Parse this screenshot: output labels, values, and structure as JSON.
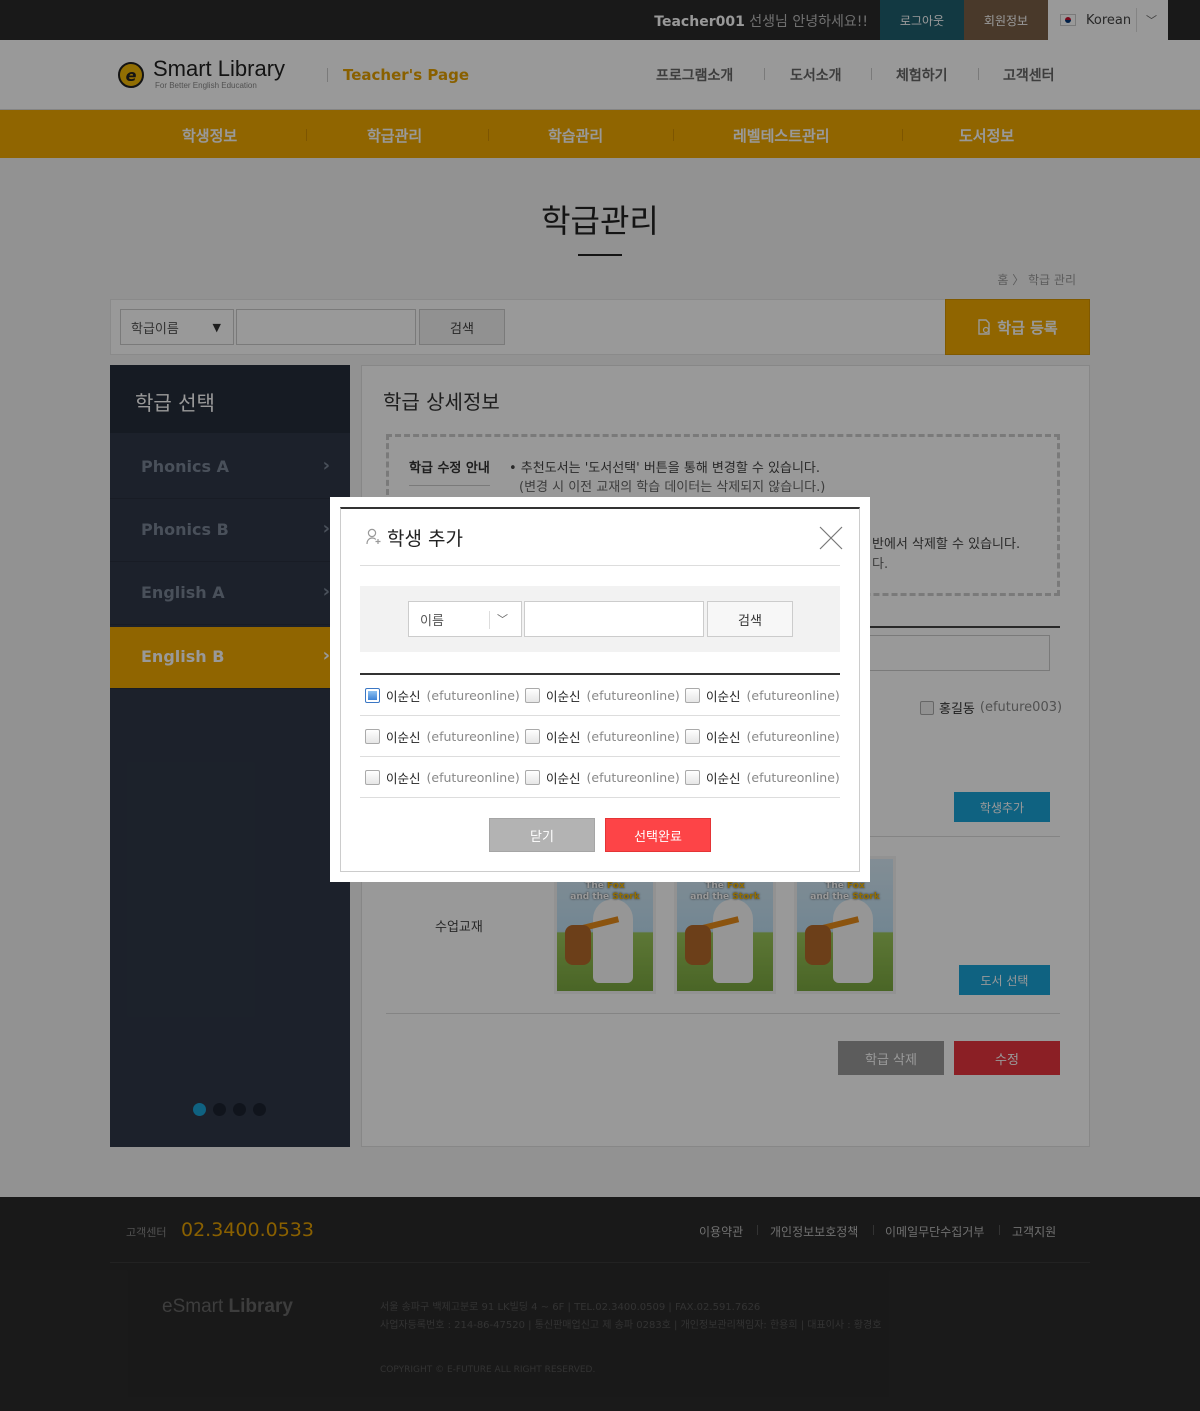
{
  "top_bar": {
    "user": "Teacher001",
    "greeting": " 선생님 안녕하세요!!",
    "logout": "로그아웃",
    "member_info": "회원정보",
    "language": "Korean"
  },
  "header": {
    "logo_mark": "e",
    "logo_text": "Smart Library",
    "logo_sub": "For Better English Education",
    "teacher_page": "Teacher's Page",
    "nav": [
      "프로그램소개",
      "도서소개",
      "체험하기",
      "고객센터"
    ]
  },
  "main_nav": [
    "학생정보",
    "학급관리",
    "학습관리",
    "레벨테스트관리",
    "도서정보"
  ],
  "page": {
    "title": "학급관리",
    "breadcrumb": "홈  〉 학급 관리"
  },
  "search": {
    "select_value": "학급이름",
    "button": "검색",
    "register_button": "학급 등록"
  },
  "sidebar": {
    "title": "학급 선택",
    "items": [
      {
        "label": "Phonics A"
      },
      {
        "label": "Phonics B"
      },
      {
        "label": "English A"
      },
      {
        "label": "English B",
        "active": true
      }
    ],
    "pagination_active": 1,
    "pagination_count": 4
  },
  "detail": {
    "title": "학급 상세정보",
    "guide_label": "학급 수정 안내",
    "guide_1": "• 추천도서는 '도서선택' 버튼을 통해 변경할 수 있습니다.",
    "guide_1b": "(변경 시 이전 교재의 학습 데이터는 삭제되지 않습니다.)",
    "guide_2": "반에서 삭제할 수 있습니다.",
    "guide_2b": "다.",
    "student_partial_1": ")",
    "student_partial_2": ")",
    "student_name": "홍길동",
    "student_id": "(efuture003)",
    "add_student": "학생추가",
    "books_label": "수업교재",
    "book_title_1": "The",
    "book_title_2": "Fox",
    "book_title_3": "and the",
    "book_title_4": "Stork",
    "book_select": "도서 선택",
    "delete": "학급 삭제",
    "edit": "수정"
  },
  "modal": {
    "title": "학생 추가",
    "select_value": "이름",
    "search_button": "검색",
    "students": [
      {
        "name": "이순신",
        "id": "(efutureonline)",
        "checked": true
      },
      {
        "name": "이순신",
        "id": "(efutureonline)",
        "checked": false
      },
      {
        "name": "이순신",
        "id": "(efutureonline)",
        "checked": false
      },
      {
        "name": "이순신",
        "id": "(efutureonline)",
        "checked": false
      },
      {
        "name": "이순신",
        "id": "(efutureonline)",
        "checked": false
      },
      {
        "name": "이순신",
        "id": "(efutureonline)",
        "checked": false
      },
      {
        "name": "이순신",
        "id": "(efutureonline)",
        "checked": false
      },
      {
        "name": "이순신",
        "id": "(efutureonline)",
        "checked": false
      },
      {
        "name": "이순신",
        "id": "(efutureonline)",
        "checked": false
      }
    ],
    "close_button": "닫기",
    "done_button": "선택완료"
  },
  "footer": {
    "cs_label": "고객센터",
    "phone": "02.3400.0533",
    "links": [
      "이용약관",
      "개인정보보호정책",
      "이메일무단수집거부",
      "고객지원"
    ],
    "logo_light": "eSmart ",
    "logo_bold": "Library",
    "address_1": "서울 송파구 백제고분로 91 LK빌딩 4 ~ 6F   |   TEL.02.3400.0509   |   FAX.02.591.7626",
    "address_2": "사업자등록번호 : 214-86-47520   |   통신판매업신고 제 송파 0283호   |   개인정보관리책임자: 한용희   |   대표이사 : 황경호",
    "copyright": "COPYRIGHT © E-FUTURE ALL RIGHT RESERVED."
  },
  "colors": {
    "accent": "#f0a800",
    "sidebar": "#2f3848",
    "blue_button": "#1aa3d8",
    "red_button": "#e8343f"
  }
}
